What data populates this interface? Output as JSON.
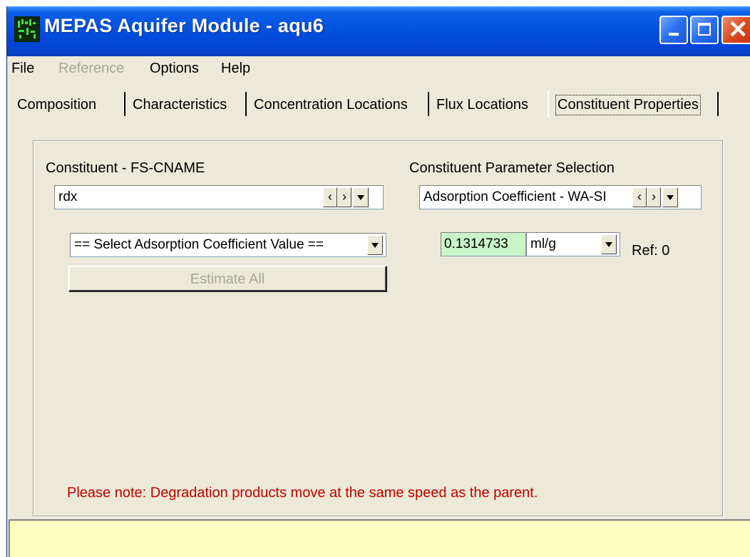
{
  "window": {
    "title": "MEPAS Aquifer Module - aqu6"
  },
  "menu": {
    "file": "File",
    "reference": "Reference",
    "options": "Options",
    "help": "Help"
  },
  "tabs": {
    "composition": "Composition",
    "characteristics": "Characteristics",
    "concentration_locations": "Concentration Locations",
    "flux_locations": "Flux Locations",
    "constituent_properties": "Constituent Properties"
  },
  "constituent": {
    "label": "Constituent - FS-CNAME",
    "value": "rdx",
    "select_placeholder": "== Select Adsorption Coefficient Value ==",
    "estimate_button": "Estimate All"
  },
  "parameter": {
    "label": "Constituent Parameter Selection",
    "value": "Adsorption Coefficient - WA-SI",
    "numeric_value": "0.1314733",
    "unit": "ml/g",
    "ref": "Ref: 0"
  },
  "note": "Please note: Degradation products move at the same speed as the parent.",
  "colors": {
    "note_red": "#c00000",
    "value_green": "#c8f5c8",
    "status_yellow": "#ffffc4",
    "title_blue": "#0553e0"
  }
}
